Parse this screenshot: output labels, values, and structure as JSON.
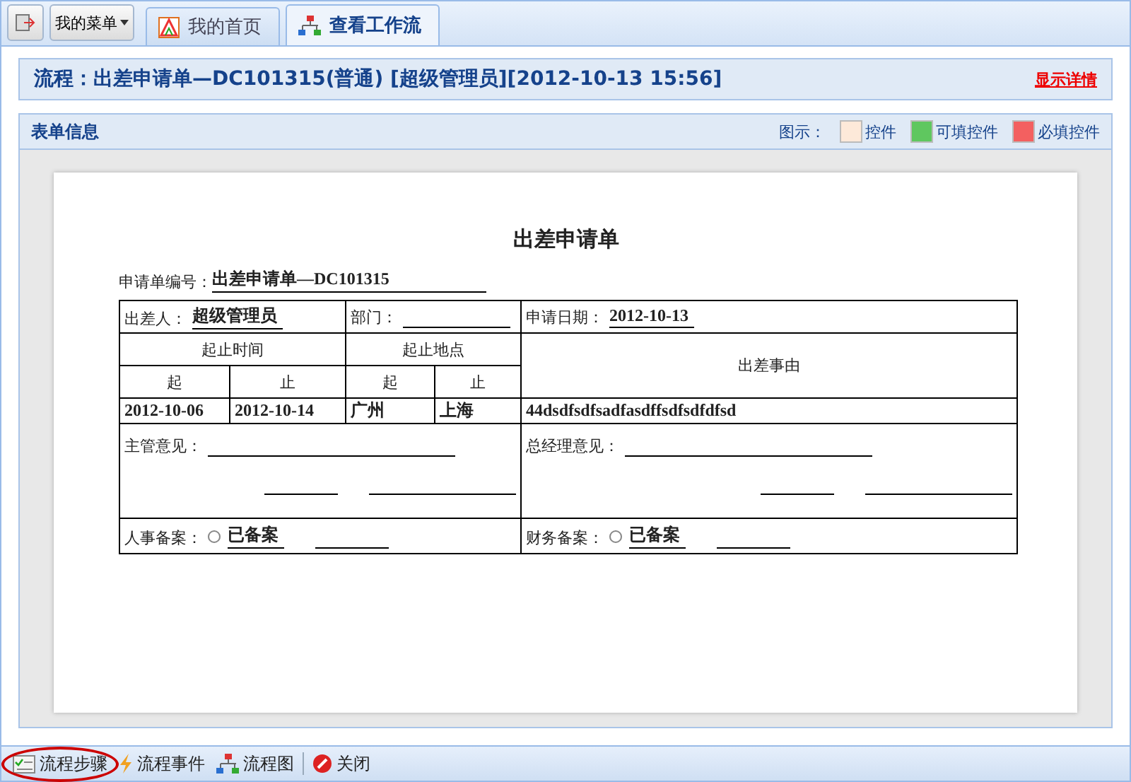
{
  "menu_button": {
    "label": "我的菜单"
  },
  "tabs": [
    {
      "label": "我的首页",
      "kind": "home",
      "selected": false
    },
    {
      "label": "查看工作流",
      "kind": "workflow",
      "selected": true
    }
  ],
  "flow_header": {
    "text": "流程：出差申请单—DC101315(普通) [超级管理员][2012-10-13 15:56]",
    "link": "显示详情"
  },
  "form_panel": {
    "title": "表单信息",
    "legend_label": "图示：",
    "legend": [
      {
        "label": "控件",
        "color": "#fde9d9"
      },
      {
        "label": "可填控件",
        "color": "#5fc75f"
      },
      {
        "label": "必填控件",
        "color": "#f36060"
      }
    ]
  },
  "form": {
    "title": "出差申请单",
    "number": {
      "label": "申请单编号：",
      "value": "出差申请单—DC101315"
    },
    "applicant": {
      "label": "出差人：",
      "value": "超级管理员"
    },
    "department": {
      "label": "部门："
    },
    "date": {
      "label": "申请日期：",
      "value": "2012-10-13"
    },
    "time_header": "起止时间",
    "place_header": "起止地点",
    "reason_header": "出差事由",
    "sub_headers": [
      "起",
      "止",
      "起",
      "止"
    ],
    "values": [
      "2012-10-06",
      "2012-10-14",
      "广州",
      "上海"
    ],
    "reason": "44dsdfsdfsadfasdffsdfsdfdfsd",
    "supervisor_label": "主管意见：",
    "manager_label": "总经理意见：",
    "hr": {
      "label": "人事备案：",
      "option": "已备案",
      "selected": false
    },
    "finance": {
      "label": "财务备案：",
      "option": "已备案",
      "selected": false
    }
  },
  "bottom_toolbar": [
    {
      "label": "流程步骤",
      "kind": "steps",
      "highlighted": true
    },
    {
      "label": "流程事件",
      "kind": "events",
      "highlighted": false
    },
    {
      "label": "流程图",
      "kind": "chart",
      "highlighted": false
    },
    {
      "label": "关闭",
      "kind": "close",
      "highlighted": false
    }
  ]
}
